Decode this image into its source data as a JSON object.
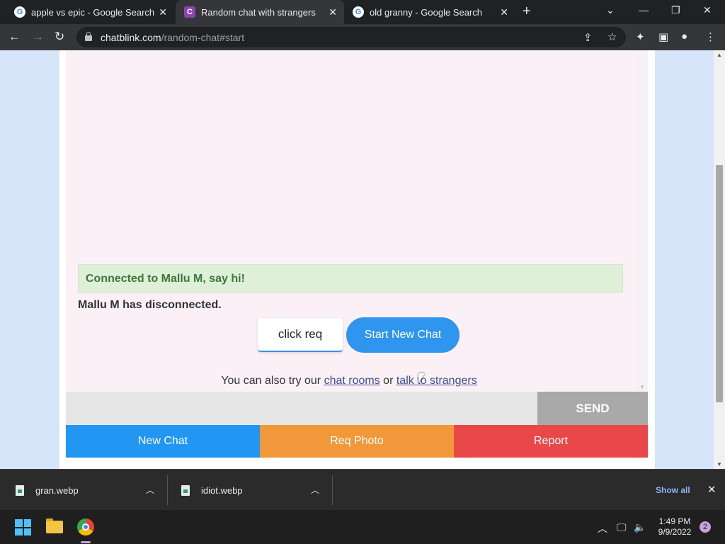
{
  "browser": {
    "tabs": [
      {
        "title": "apple vs epic - Google Search",
        "favicon": "google-icon",
        "active": false
      },
      {
        "title": "Random chat with strangers",
        "favicon": "chatblink-icon",
        "active": true
      },
      {
        "title": "old granny - Google Search",
        "favicon": "google-icon",
        "active": false
      }
    ],
    "url_host": "chatblink.com",
    "url_path": "/random-chat#start"
  },
  "chat": {
    "connected_message": "Connected to Mallu M, say hi!",
    "disconnected_message": "Mallu M has disconnected.",
    "click_req_label": "click req",
    "start_new_chat_label": "Start New Chat",
    "alt_prefix": "You can also try our",
    "alt_link1": "chat rooms",
    "alt_or": "or",
    "alt_link2": "talk to strangers",
    "message_input_value": "",
    "send_label": "SEND",
    "actions": {
      "new_chat": "New Chat",
      "req_photo": "Req Photo",
      "report": "Report"
    },
    "colors": {
      "new_chat": "#2196f3",
      "req_photo": "#f0983a",
      "report": "#ea4848",
      "connected_bg": "#dff0d8",
      "connected_text": "#3c763d"
    }
  },
  "downloads": {
    "items": [
      {
        "name": "gran.webp"
      },
      {
        "name": "idiot.webp"
      }
    ],
    "show_all": "Show all"
  },
  "taskbar": {
    "time": "1:49 PM",
    "date": "9/9/2022",
    "notification_count": "2"
  }
}
